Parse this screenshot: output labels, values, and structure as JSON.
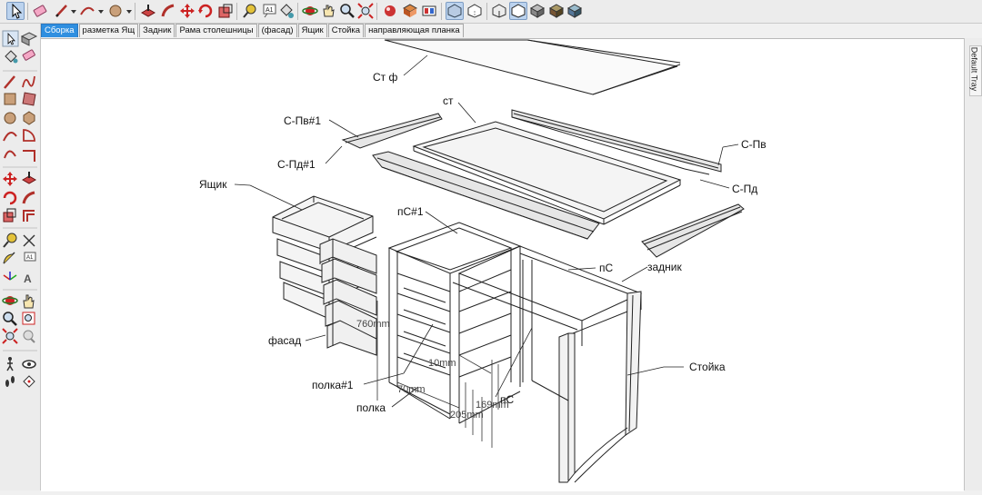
{
  "toolbar": {
    "buttons": [
      {
        "icon": "select-arrow-icon",
        "active": true
      },
      {
        "icon": "eraser-icon"
      },
      {
        "icon": "pencil-line-icon"
      },
      {
        "icon": "arc-icon"
      },
      {
        "icon": "circle-icon"
      },
      {
        "icon": "push-pull-icon"
      },
      {
        "icon": "follow-me-icon"
      },
      {
        "icon": "move-icon"
      },
      {
        "icon": "rotate-icon"
      },
      {
        "icon": "scale-icon"
      },
      {
        "icon": "tape-measure-icon"
      },
      {
        "icon": "text-icon"
      },
      {
        "icon": "paint-bucket-icon"
      },
      {
        "icon": "orbit-icon"
      },
      {
        "icon": "pan-icon"
      },
      {
        "icon": "zoom-icon"
      },
      {
        "icon": "zoom-extents-icon"
      },
      {
        "icon": "materials-icon"
      },
      {
        "icon": "components-icon"
      },
      {
        "icon": "styles-icon"
      },
      {
        "icon": "xray-icon",
        "active": true
      },
      {
        "icon": "back-edges-icon"
      },
      {
        "icon": "wireframe-icon"
      },
      {
        "icon": "hidden-line-icon",
        "active": true
      },
      {
        "icon": "shaded-icon"
      },
      {
        "icon": "shaded-textures-icon"
      },
      {
        "icon": "monochrome-icon"
      }
    ]
  },
  "tabs": [
    {
      "label": "Сборка",
      "active": true
    },
    {
      "label": "разметка Ящ"
    },
    {
      "label": "Задник"
    },
    {
      "label": "Рама столешницы"
    },
    {
      "label": "(фасад)"
    },
    {
      "label": "Ящик"
    },
    {
      "label": "Стойка"
    },
    {
      "label": "направляющая планка"
    }
  ],
  "left_tools": [
    "select-icon",
    "component-icon",
    "paint-icon",
    "eraser-icon",
    "pencil-icon",
    "freehand-icon",
    "rectangle-icon",
    "rotated-rectangle-icon",
    "circle-icon",
    "polygon-icon",
    "arc-icon",
    "pie-icon",
    "two-point-arc-icon",
    "three-point-arc-icon",
    "move-icon",
    "push-pull-icon",
    "rotate-icon",
    "follow-me-icon",
    "scale-icon",
    "offset-icon",
    "tape-measure-icon",
    "dimension-icon",
    "protractor-icon",
    "text-icon",
    "axes-icon",
    "3d-text-icon",
    "orbit-icon",
    "pan-icon",
    "zoom-icon",
    "zoom-window-icon",
    "zoom-extents-icon",
    "previous-view-icon",
    "walk-icon",
    "look-around-icon",
    "footprints-icon",
    "section-plane-icon"
  ],
  "right_tray": {
    "label": "Default Tray"
  },
  "labels": {
    "st_f": "Ст ф",
    "st": "ст",
    "s_pv1": "С-Пв#1",
    "s_pd1": "С-Пд#1",
    "s_pv": "С-Пв",
    "s_pd": "С-Пд",
    "yashchik": "Ящик",
    "ps1": "пС#1",
    "ps_top": "пС",
    "zadnik": "задник",
    "fasad": "фасад",
    "stoyka": "Стойка",
    "polka1": "полка#1",
    "polka": "полка",
    "ps_low": "пС"
  },
  "dimensions": {
    "d1": "760mm",
    "d2": "10mm",
    "d3": "70mm",
    "d4": "169mm",
    "d5": "205mm"
  },
  "colors": {
    "tab_active": "#2f8fe0",
    "toolbar_bg": "#ececec",
    "model_line": "#222222",
    "model_fill": "#d9d9d9"
  }
}
